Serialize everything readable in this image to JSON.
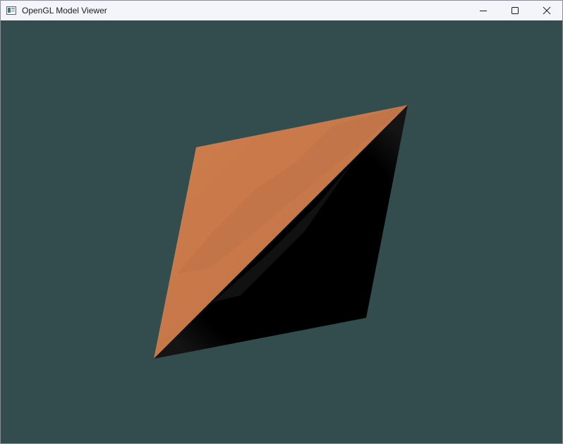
{
  "window": {
    "title": "OpenGL Model Viewer",
    "app_icon": "opengl-app-icon",
    "buttons": {
      "minimize": "minimize-icon",
      "maximize": "maximize-icon",
      "close": "close-icon"
    }
  },
  "scene": {
    "clear_color": "#334c4d",
    "model": "shaded-quad",
    "lit_face_color": "#c97a4a",
    "dark_face_color": "#000000"
  }
}
